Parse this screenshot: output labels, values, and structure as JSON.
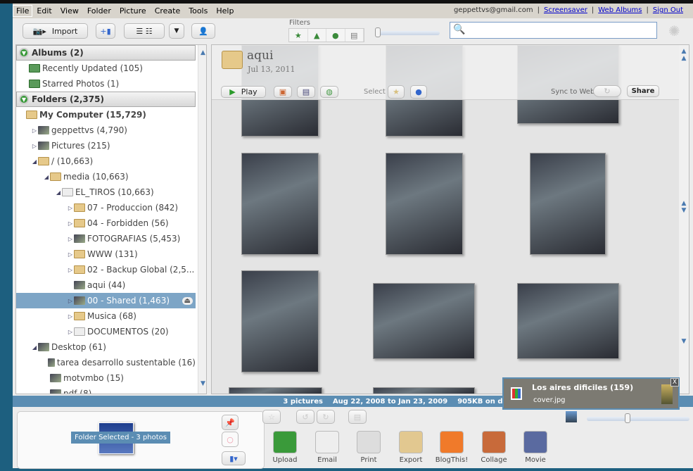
{
  "menu": [
    "File",
    "Edit",
    "View",
    "Folder",
    "Picture",
    "Create",
    "Tools",
    "Help"
  ],
  "account": {
    "email": "geppettvs@gmail.com",
    "links": [
      "Screensaver",
      "Web Albums",
      "Sign Out"
    ]
  },
  "toolbar": {
    "import": "Import",
    "filters_label": "Filters",
    "search_placeholder": ""
  },
  "sidebar": {
    "albums_header": "Albums (2)",
    "albums": [
      "Recently Updated (105)",
      "Starred Photos (1)"
    ],
    "folders_header": "Folders (2,375)",
    "tree": [
      {
        "label": "My Computer (15,729)",
        "level": 0,
        "icon": "folder",
        "bold": true
      },
      {
        "label": "geppettvs (4,790)",
        "level": 1,
        "icon": "thumb"
      },
      {
        "label": "Pictures (215)",
        "level": 1,
        "icon": "thumb"
      },
      {
        "label": "/ (10,663)",
        "level": 1,
        "icon": "folder"
      },
      {
        "label": "media (10,663)",
        "level": 2,
        "icon": "folder"
      },
      {
        "label": "EL_TIROS (10,663)",
        "level": 3,
        "icon": "drive"
      },
      {
        "label": "07 - Produccion (842)",
        "level": 4,
        "icon": "folder"
      },
      {
        "label": "04 - Forbidden (56)",
        "level": 4,
        "icon": "folder"
      },
      {
        "label": "FOTOGRAFIAS (5,453)",
        "level": 4,
        "icon": "thumb"
      },
      {
        "label": "WWW (131)",
        "level": 4,
        "icon": "folder"
      },
      {
        "label": "02 - Backup Global (2,5...",
        "level": 4,
        "icon": "folder"
      },
      {
        "label": "aqui (44)",
        "level": 4,
        "icon": "thumb"
      },
      {
        "label": "00 - Shared (1,463)",
        "level": 4,
        "icon": "thumb",
        "selected": true
      },
      {
        "label": "Musica (68)",
        "level": 4,
        "icon": "folder"
      },
      {
        "label": "DOCUMENTOS (20)",
        "level": 4,
        "icon": "drive"
      },
      {
        "label": "Desktop (61)",
        "level": 1,
        "icon": "thumb"
      },
      {
        "label": "tarea desarrollo sustentable (16)",
        "level": 2,
        "icon": "thumb"
      },
      {
        "label": "motvmbo (15)",
        "level": 2,
        "icon": "thumb"
      },
      {
        "label": "pdf (8)",
        "level": 2,
        "icon": "thumb"
      }
    ]
  },
  "folder": {
    "name": "aqui",
    "date": "Jul 13, 2011",
    "play": "Play",
    "select": "Select",
    "sync": "Sync to Web",
    "share": "Share"
  },
  "status": {
    "count": "3 pictures",
    "range": "Aug 22, 2008 to Jan 23, 2009",
    "size": "905KB on disk"
  },
  "tray": {
    "label": "Folder Selected - 3 photos"
  },
  "actions": [
    "Upload",
    "Email",
    "Print",
    "Export",
    "BlogThis!",
    "Collage",
    "Movie"
  ],
  "notification": {
    "title": "Los aires dificiles (159)",
    "file": "cover.jpg"
  },
  "colors": {
    "status_bar": "#5b8db3",
    "selection": "#7da5c6"
  }
}
